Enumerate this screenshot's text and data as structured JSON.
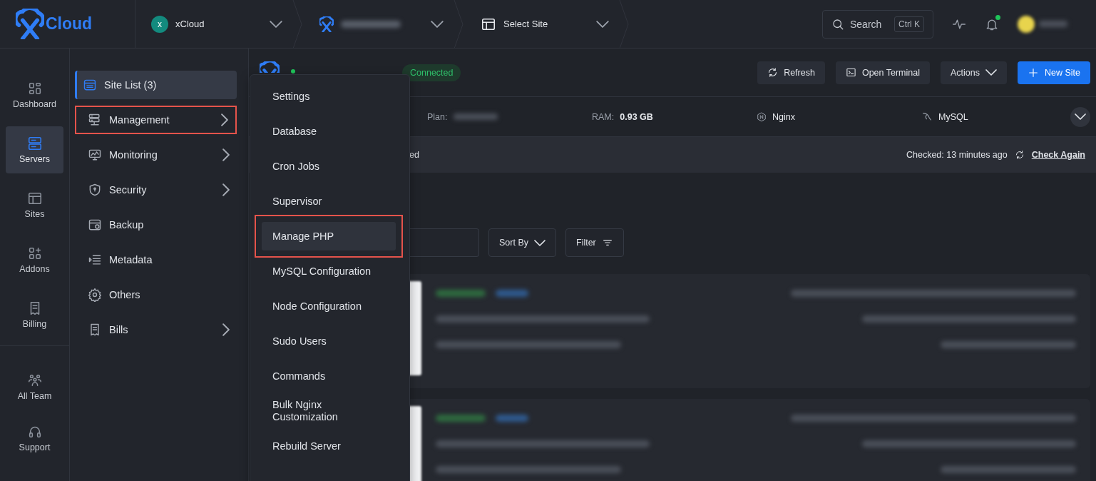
{
  "topbar": {
    "logo": "Cloud",
    "breadcrumbs": [
      {
        "kind": "team",
        "avatar": "x",
        "label": "xCloud"
      },
      {
        "kind": "server"
      },
      {
        "kind": "site",
        "label": "Select Site"
      }
    ],
    "search": {
      "label": "Search",
      "shortcut": "Ctrl K"
    },
    "notifications": {
      "unread": true
    }
  },
  "rail": {
    "primary": [
      {
        "label": "Dashboard",
        "selected": false
      },
      {
        "label": "Servers",
        "selected": true
      },
      {
        "label": "Sites",
        "selected": false
      },
      {
        "label": "Addons",
        "selected": false
      },
      {
        "label": "Billing",
        "selected": false
      }
    ],
    "secondary": [
      {
        "label": "All Team",
        "selected": false
      },
      {
        "label": "Support",
        "selected": false
      }
    ]
  },
  "submenu": [
    {
      "label": "Site List (3)",
      "selected": true,
      "highlighted": false,
      "has_children": false
    },
    {
      "label": "Management",
      "selected": false,
      "highlighted": true,
      "has_children": true
    },
    {
      "label": "Monitoring",
      "selected": false,
      "highlighted": false,
      "has_children": true
    },
    {
      "label": "Security",
      "selected": false,
      "highlighted": false,
      "has_children": true
    },
    {
      "label": "Backup",
      "selected": false,
      "highlighted": false,
      "has_children": false
    },
    {
      "label": "Metadata",
      "selected": false,
      "highlighted": false,
      "has_children": false
    },
    {
      "label": "Others",
      "selected": false,
      "highlighted": false,
      "has_children": false
    },
    {
      "label": "Bills",
      "selected": false,
      "highlighted": false,
      "has_children": true
    }
  ],
  "dropdown": [
    {
      "label": "Settings",
      "selected": false,
      "highlighted": false
    },
    {
      "label": "Database",
      "selected": false,
      "highlighted": false
    },
    {
      "label": "Cron Jobs",
      "selected": false,
      "highlighted": false
    },
    {
      "label": "Supervisor",
      "selected": false,
      "highlighted": false
    },
    {
      "label": "Manage PHP",
      "selected": true,
      "highlighted": true
    },
    {
      "label": "MySQL Configuration",
      "selected": false,
      "highlighted": false
    },
    {
      "label": "Node Configuration",
      "selected": false,
      "highlighted": false
    },
    {
      "label": "Sudo Users",
      "selected": false,
      "highlighted": false
    },
    {
      "label": "Commands",
      "selected": false,
      "highlighted": false
    },
    {
      "label": "Bulk Nginx Customization",
      "selected": false,
      "highlighted": false
    },
    {
      "label": "Rebuild Server",
      "selected": false,
      "highlighted": false
    }
  ],
  "server": {
    "online": true,
    "status": "Connected",
    "actions": [
      {
        "kind": "refresh",
        "label": "Refresh"
      },
      {
        "kind": "terminal",
        "label": "Open Terminal"
      },
      {
        "kind": "menu",
        "label": "Actions"
      },
      {
        "kind": "primary",
        "label": "New Site"
      }
    ]
  },
  "info": {
    "plan_label": "Plan:",
    "ram_label": "RAM:",
    "ram": "0.93 GB",
    "web_server": "Nginx",
    "database": "MySQL"
  },
  "check": {
    "message": "ed",
    "checked": "Checked: 13 minutes ago",
    "link": "Check Again"
  },
  "toolbar": {
    "sort": "Sort By",
    "filter": "Filter"
  },
  "site_cards": [
    {
      "kind": "blurred"
    },
    {
      "kind": "blurred"
    }
  ]
}
